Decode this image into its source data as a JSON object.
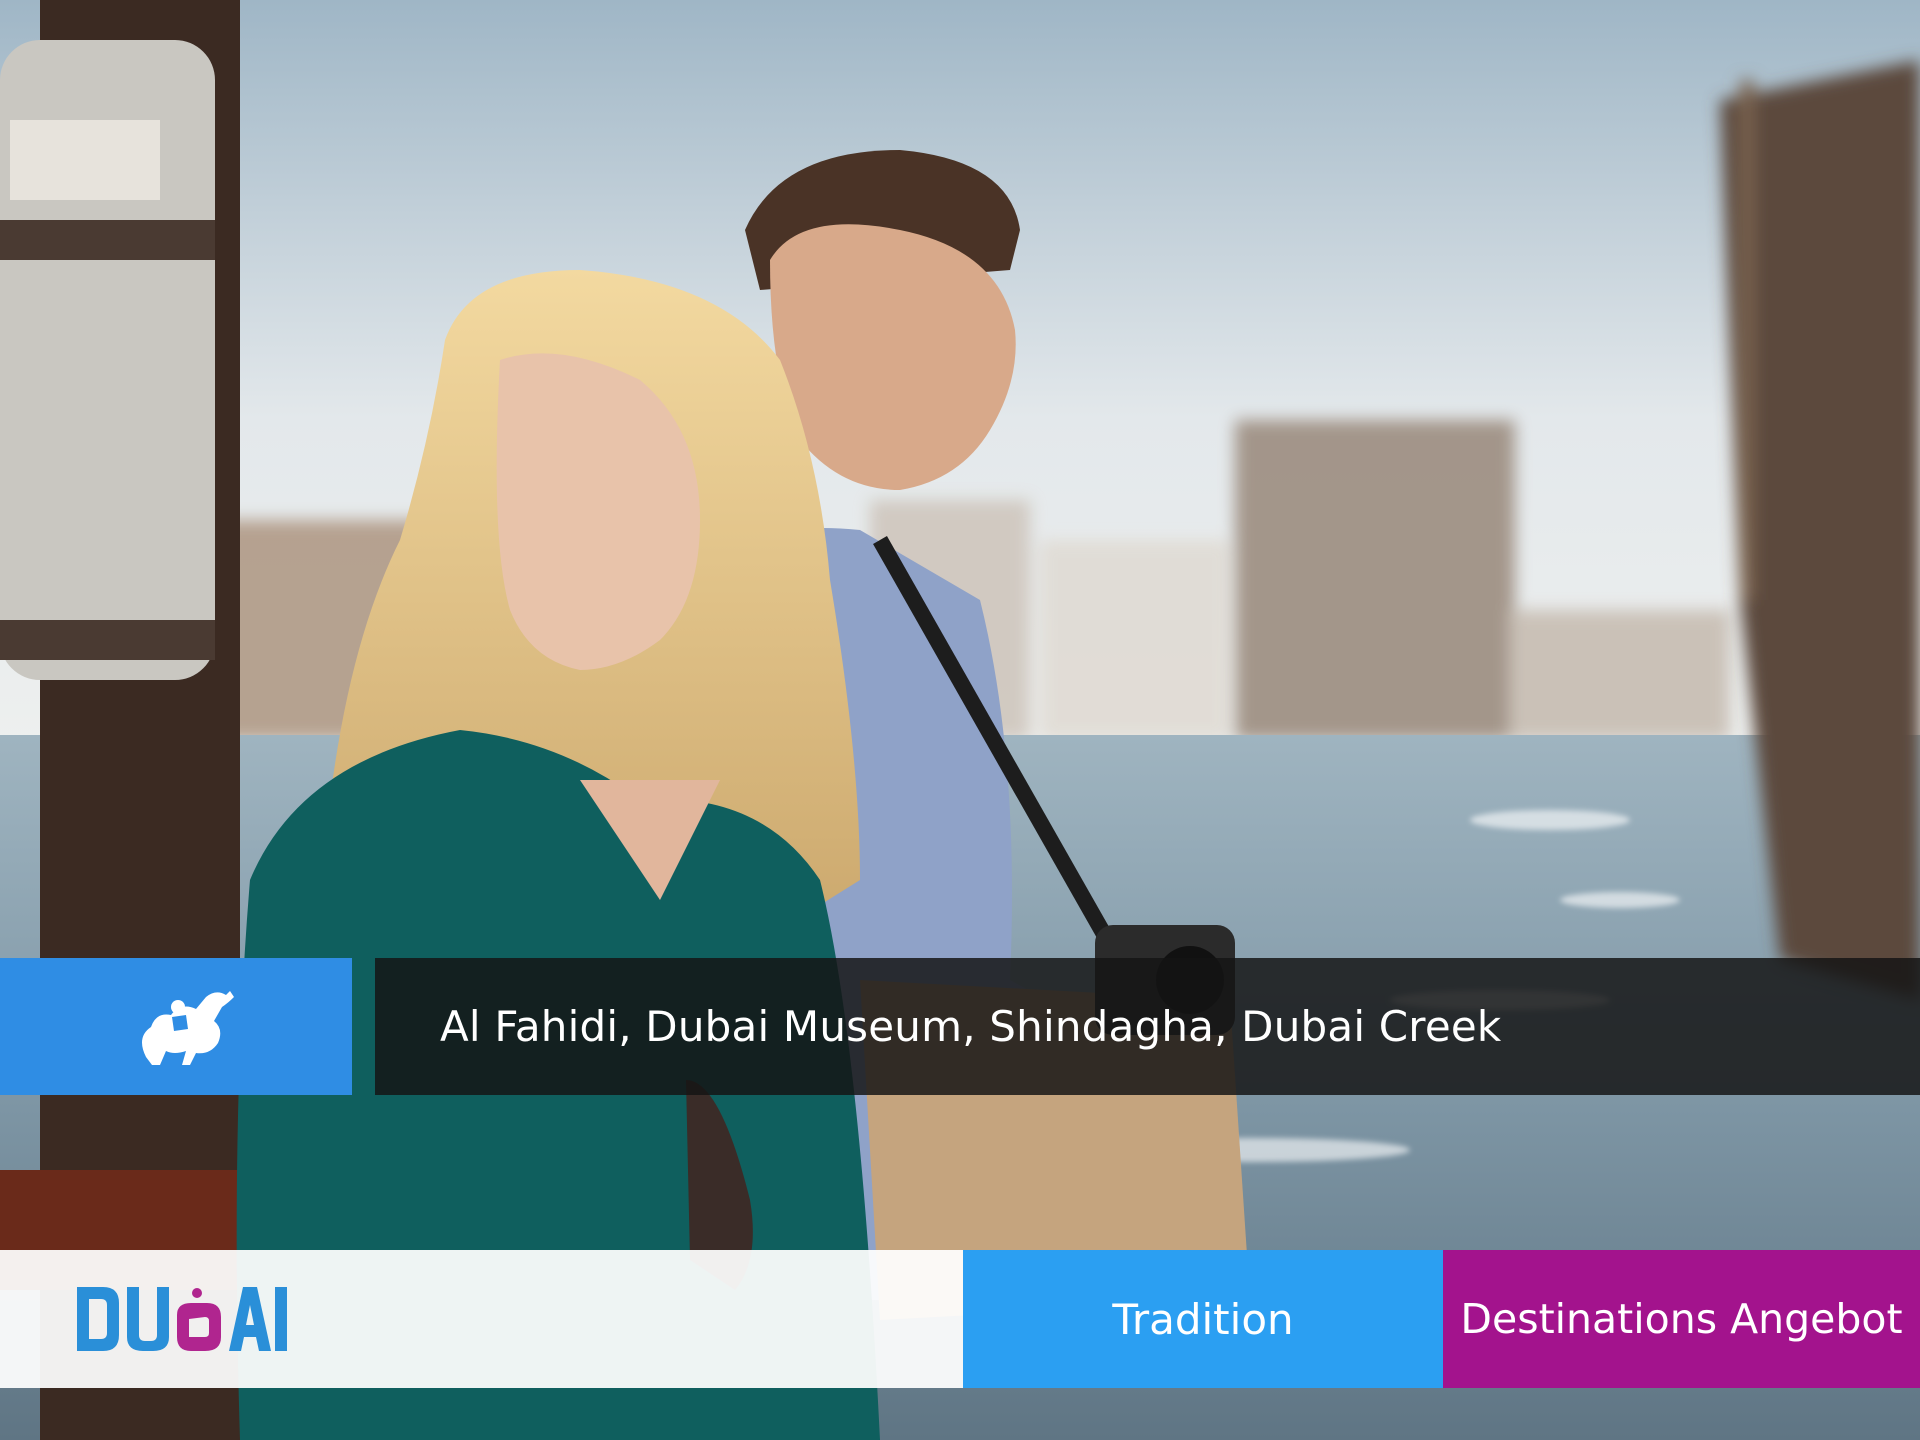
{
  "hero": {
    "scene": "couple-on-abra-boat-dubai-creek",
    "caption": "Al Fahidi, Dubai Museum, Shindagha, Dubai Creek",
    "caption_icon": "camel-rider-icon"
  },
  "footer": {
    "logo_text": "DUBAI",
    "tags": {
      "tradition": "Tradition",
      "destinations": "Destinations Angebot"
    }
  },
  "colors": {
    "icon_box": "#2f8de4",
    "caption_bar": "#141414",
    "tradition": "#2b9ff2",
    "destinations": "#a3138d",
    "logo_blue": "#2a8fd8",
    "logo_magenta": "#b0258f"
  }
}
